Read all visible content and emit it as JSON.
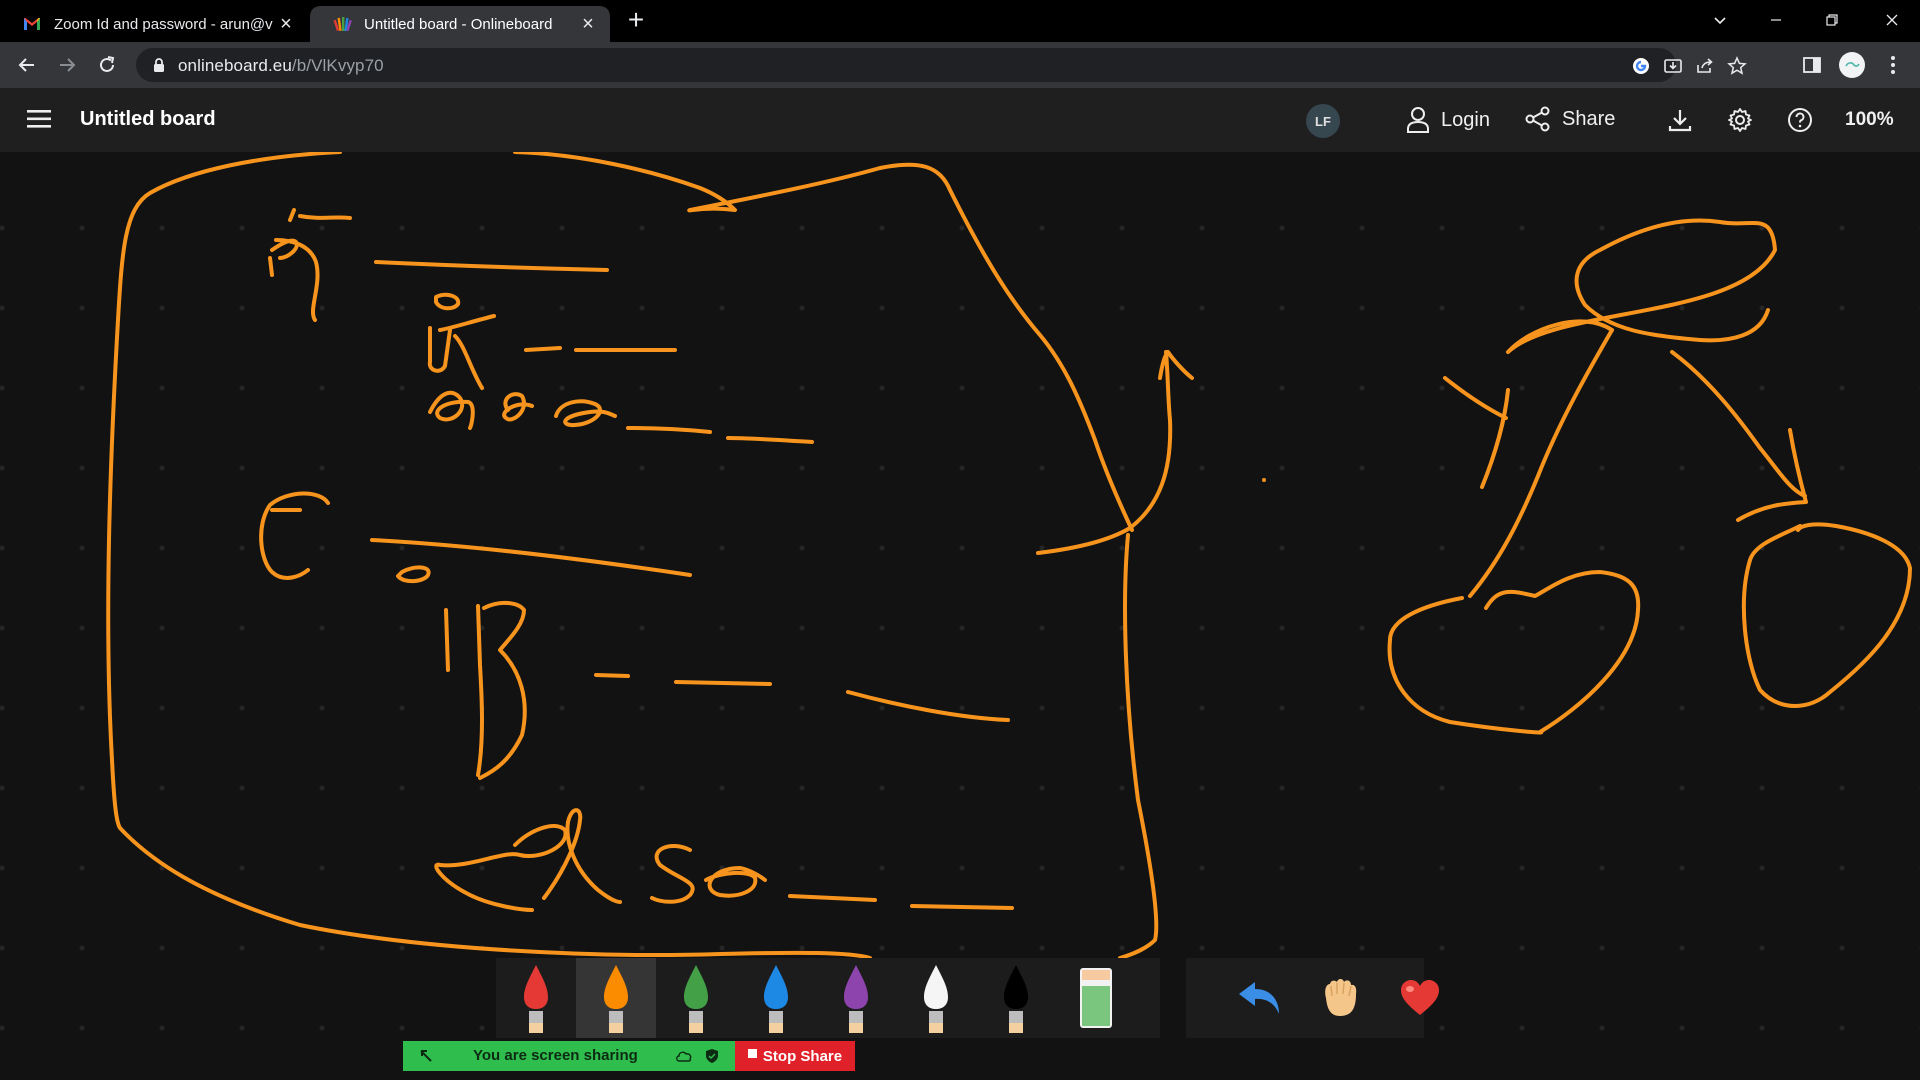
{
  "browser": {
    "tabs": [
      {
        "title": "Zoom Id and password - arun@v",
        "icon": "gmail-icon"
      },
      {
        "title": "Untitled board - Onlineboard",
        "icon": "onlineboard-icon",
        "active": true
      }
    ],
    "url_domain": "onlineboard.eu",
    "url_path": "/b/VlKvyp70"
  },
  "app": {
    "title": "Untitled board",
    "avatar_initials": "LF",
    "login_label": "Login",
    "share_label": "Share",
    "zoom_level": "100%"
  },
  "palette": {
    "colors": [
      {
        "name": "red",
        "hex": "#e53935"
      },
      {
        "name": "orange",
        "hex": "#fb8c00",
        "selected": true
      },
      {
        "name": "green",
        "hex": "#43a047"
      },
      {
        "name": "blue",
        "hex": "#1e88e5"
      },
      {
        "name": "purple",
        "hex": "#8e44ad"
      },
      {
        "name": "white",
        "hex": "#f5f5f5"
      },
      {
        "name": "black",
        "hex": "#000000"
      }
    ],
    "stroke_color": "#f7941d",
    "extra_tools": [
      "eraser-icon",
      "undo-icon",
      "hand-icon",
      "heart-icon"
    ]
  },
  "zoom_share": {
    "sharing_label": "You are screen sharing",
    "stop_label": "Stop Share"
  }
}
